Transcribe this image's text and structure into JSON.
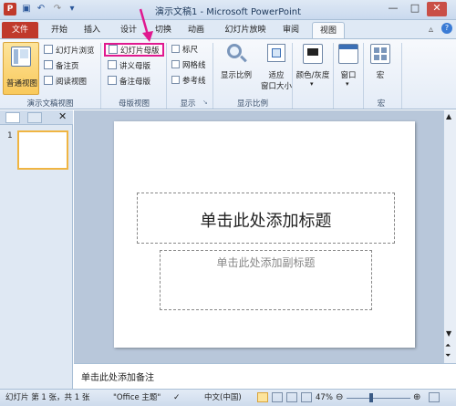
{
  "window": {
    "title": "演示文稿1 - Microsoft PowerPoint",
    "minimize_label": "—",
    "maximize_label": "□",
    "close_label": "✕"
  },
  "tabs": [
    "文件",
    "开始",
    "插入",
    "设计",
    "切换",
    "动画",
    "幻灯片放映",
    "审阅",
    "视图"
  ],
  "active_tab": "视图",
  "ribbon": {
    "presentation_views": {
      "normal_label": "普通视图",
      "slide_sorter_label": "幻灯片浏览",
      "notes_page_label": "备注页",
      "reading_view_label": "阅读视图",
      "group_label": "演示文稿视图"
    },
    "master_views": {
      "slide_master_label": "幻灯片母版",
      "handout_master_label": "讲义母版",
      "notes_master_label": "备注母版",
      "group_label": "母版视图"
    },
    "show": {
      "ruler_label": "标尺",
      "gridlines_label": "网格线",
      "guides_label": "参考线",
      "group_label": "显示"
    },
    "zoom": {
      "zoom_label": "显示比例",
      "fit_label_1": "适应",
      "fit_label_2": "窗口大小",
      "group_label": "显示比例"
    },
    "color": {
      "label": "颜色/灰度"
    },
    "window_group": {
      "label": "窗口"
    },
    "macros": {
      "label": "宏",
      "group_label": "宏"
    }
  },
  "slide_pane": {
    "slide_number": "1"
  },
  "slide": {
    "title_placeholder": "单击此处添加标题",
    "subtitle_placeholder": "单击此处添加副标题"
  },
  "notes": {
    "placeholder": "单击此处添加备注"
  },
  "status_bar": {
    "slide_info": "幻灯片 第 1 张，共 1 张",
    "theme": "\"Office 主题\"",
    "language": "中文(中国)",
    "zoom_percent": "47%"
  },
  "colors": {
    "accent_file": "#c0392b",
    "highlight_box": "#e0198f",
    "arrow": "#e0198f",
    "ribbon_bg": "#e4ecf7",
    "slide_bg": "#b8c7da"
  },
  "annotation_arrow": {
    "icon": "arrow-down-icon"
  }
}
